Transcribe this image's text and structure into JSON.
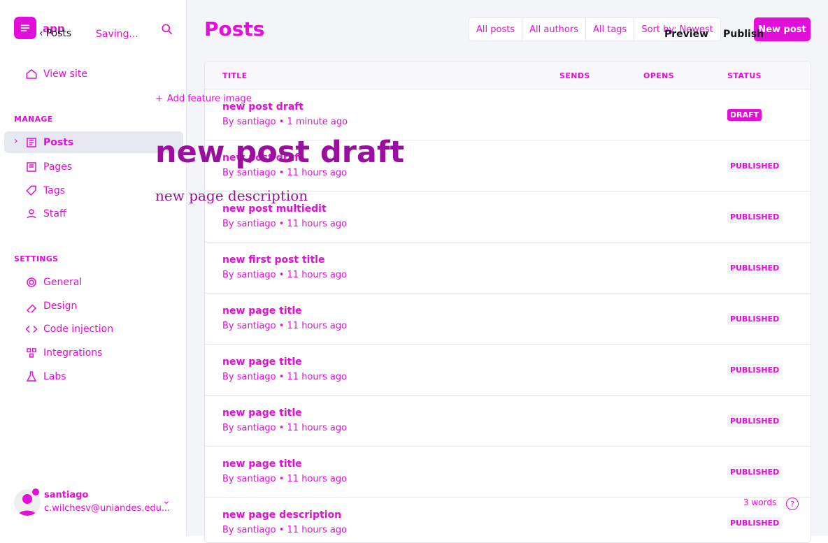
{
  "app": {
    "name": "app",
    "back": "Posts",
    "status": "Saving..."
  },
  "nav": {
    "view_site": "View site",
    "manage": "MANAGE",
    "posts": "Posts",
    "pages": "Pages",
    "tags": "Tags",
    "staff": "Staff",
    "settings": "SETTINGS",
    "general": "General",
    "design": "Design",
    "code": "Code injection",
    "integrations": "Integrations",
    "labs": "Labs"
  },
  "user": {
    "name": "santiago",
    "email": "c.wilchesv@uniandes.edu..."
  },
  "main": {
    "title": "Posts",
    "filters": [
      "All posts",
      "All authors",
      "All tags",
      "Sort by: Newest"
    ],
    "new_post": "New post",
    "preview": "Preview",
    "publish": "Publish",
    "headers": {
      "title": "TITLE",
      "sends": "SENDS",
      "opens": "OPENS",
      "status": "STATUS"
    }
  },
  "rows": [
    {
      "title": "new post draft",
      "meta": "By santiago • 1 minute ago",
      "status": "DRAFT"
    },
    {
      "title": "new post draft",
      "meta": "By santiago • 11 hours ago",
      "status": "PUBLISHED"
    },
    {
      "title": "new post multiedit",
      "meta": "By santiago • 11 hours ago",
      "status": "PUBLISHED"
    },
    {
      "title": "new first post title",
      "meta": "By santiago • 11 hours ago",
      "status": "PUBLISHED"
    },
    {
      "title": "new page title",
      "meta": "By santiago • 11 hours ago",
      "status": "PUBLISHED"
    },
    {
      "title": "new page title",
      "meta": "By santiago • 11 hours ago",
      "status": "PUBLISHED"
    },
    {
      "title": "new page title",
      "meta": "By santiago • 11 hours ago",
      "status": "PUBLISHED"
    },
    {
      "title": "new page title",
      "meta": "By santiago • 11 hours ago",
      "status": "PUBLISHED"
    },
    {
      "title": "new page description",
      "meta": "By santiago • 11 hours ago",
      "status": "PUBLISHED"
    }
  ],
  "editor": {
    "add_feature": "Add feature image",
    "title": "new post draft",
    "description": "new page description",
    "words": "3 words"
  }
}
